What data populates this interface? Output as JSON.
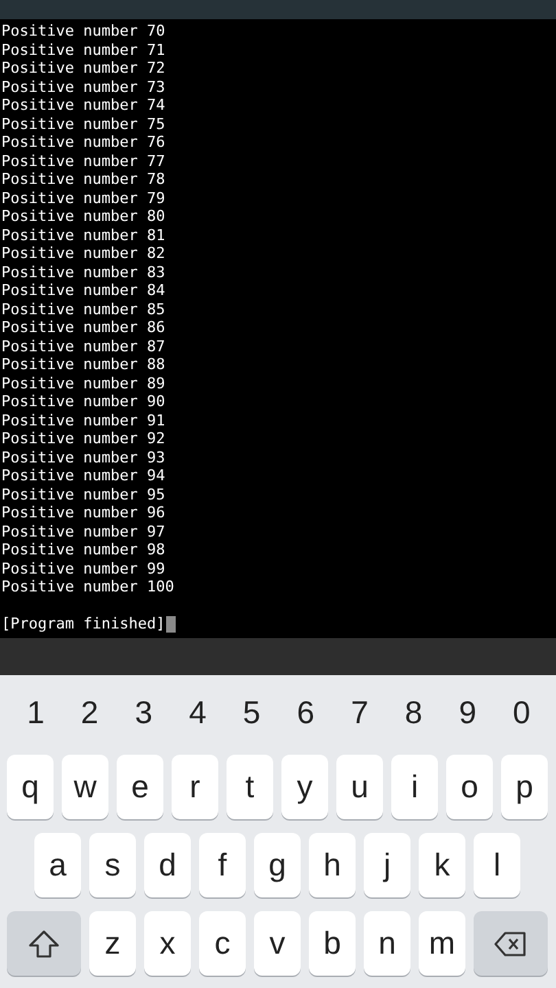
{
  "terminal": {
    "lines": [
      "Positive number 70",
      "Positive number 71",
      "Positive number 72",
      "Positive number 73",
      "Positive number 74",
      "Positive number 75",
      "Positive number 76",
      "Positive number 77",
      "Positive number 78",
      "Positive number 79",
      "Positive number 80",
      "Positive number 81",
      "Positive number 82",
      "Positive number 83",
      "Positive number 84",
      "Positive number 85",
      "Positive number 86",
      "Positive number 87",
      "Positive number 88",
      "Positive number 89",
      "Positive number 90",
      "Positive number 91",
      "Positive number 92",
      "Positive number 93",
      "Positive number 94",
      "Positive number 95",
      "Positive number 96",
      "Positive number 97",
      "Positive number 98",
      "Positive number 99",
      "Positive number 100"
    ],
    "status_line": "[Program finished]"
  },
  "keyboard": {
    "number_row": [
      "1",
      "2",
      "3",
      "4",
      "5",
      "6",
      "7",
      "8",
      "9",
      "0"
    ],
    "rows": [
      [
        {
          "kind": "letter",
          "label": "q"
        },
        {
          "kind": "letter",
          "label": "w"
        },
        {
          "kind": "letter",
          "label": "e"
        },
        {
          "kind": "letter",
          "label": "r"
        },
        {
          "kind": "letter",
          "label": "t"
        },
        {
          "kind": "letter",
          "label": "y"
        },
        {
          "kind": "letter",
          "label": "u"
        },
        {
          "kind": "letter",
          "label": "i"
        },
        {
          "kind": "letter",
          "label": "o"
        },
        {
          "kind": "letter",
          "label": "p"
        }
      ],
      [
        {
          "kind": "letter",
          "label": "a"
        },
        {
          "kind": "letter",
          "label": "s"
        },
        {
          "kind": "letter",
          "label": "d"
        },
        {
          "kind": "letter",
          "label": "f"
        },
        {
          "kind": "letter",
          "label": "g"
        },
        {
          "kind": "letter",
          "label": "h"
        },
        {
          "kind": "letter",
          "label": "j"
        },
        {
          "kind": "letter",
          "label": "k"
        },
        {
          "kind": "letter",
          "label": "l"
        }
      ],
      [
        {
          "kind": "shift"
        },
        {
          "kind": "letter",
          "label": "z"
        },
        {
          "kind": "letter",
          "label": "x"
        },
        {
          "kind": "letter",
          "label": "c"
        },
        {
          "kind": "letter",
          "label": "v"
        },
        {
          "kind": "letter",
          "label": "b"
        },
        {
          "kind": "letter",
          "label": "n"
        },
        {
          "kind": "letter",
          "label": "m"
        },
        {
          "kind": "backspace"
        }
      ]
    ]
  }
}
